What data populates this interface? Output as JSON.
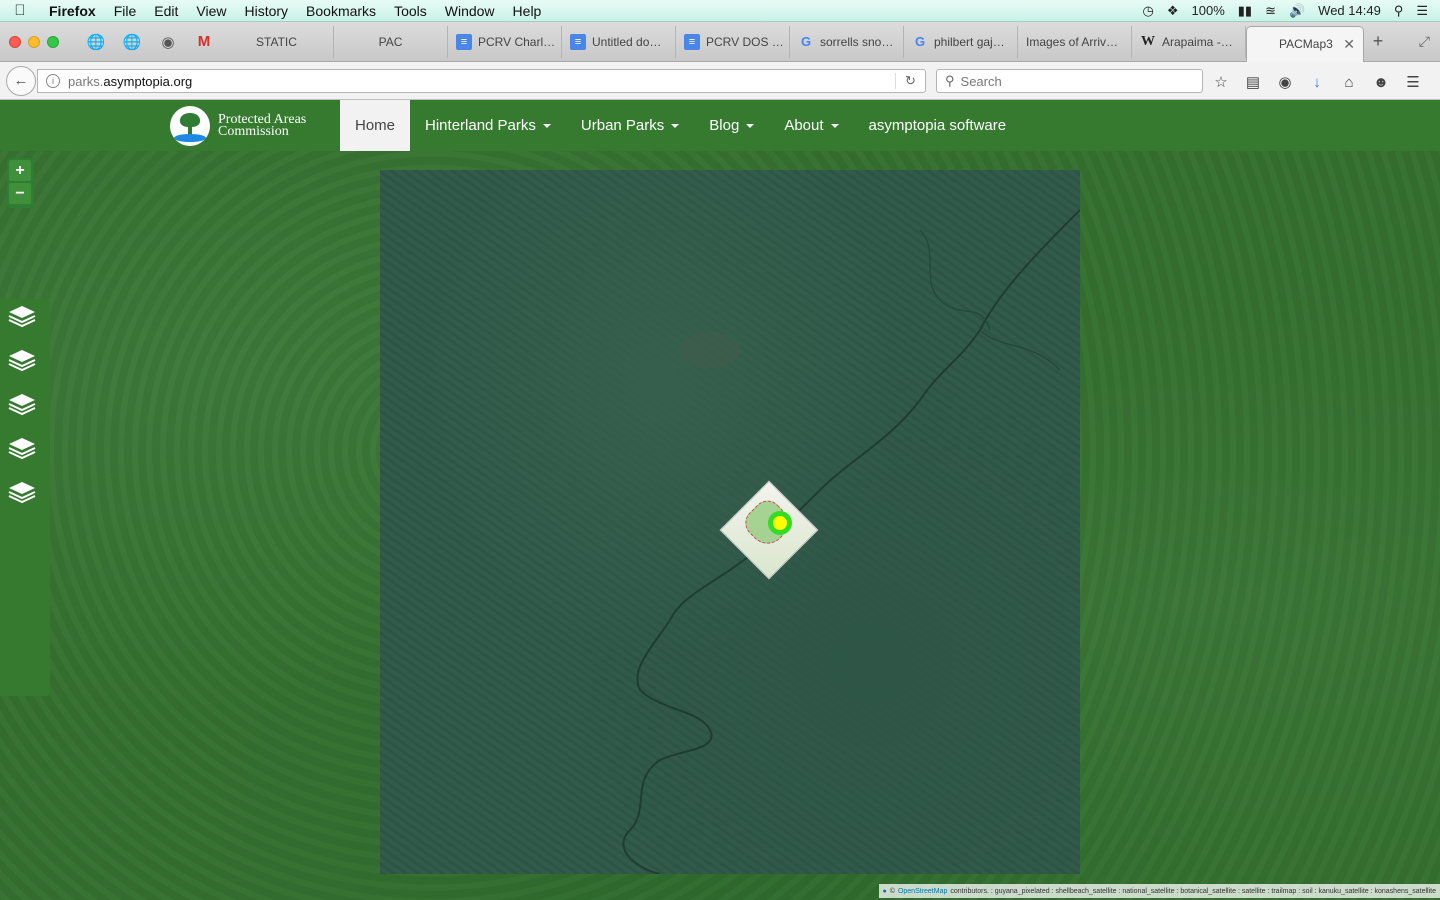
{
  "menubar": {
    "app": "Firefox",
    "items": [
      "File",
      "Edit",
      "View",
      "History",
      "Bookmarks",
      "Tools",
      "Window",
      "Help"
    ],
    "battery": "100%",
    "clock": "Wed 14:49"
  },
  "tabs": {
    "items": [
      {
        "label": "STATIC",
        "icon": "none"
      },
      {
        "label": "PAC",
        "icon": "none"
      },
      {
        "label": "PCRV Charl…",
        "icon": "docs-icon"
      },
      {
        "label": "Untitled do…",
        "icon": "docs-icon"
      },
      {
        "label": "PCRV DOS …",
        "icon": "docs-icon"
      },
      {
        "label": "sorrells sno…",
        "icon": "google-icon"
      },
      {
        "label": "philbert gaj…",
        "icon": "google-icon"
      },
      {
        "label": "Images of Arriv…",
        "icon": "none"
      },
      {
        "label": "Arapaima -…",
        "icon": "wikipedia-icon"
      }
    ],
    "active": "PACMap3"
  },
  "navbar": {
    "url_host": "parks.",
    "url_domain": "asymptopia.org",
    "search_placeholder": "Search"
  },
  "site": {
    "brand_line1": "Protected Areas",
    "brand_line2": "Commission",
    "nav": [
      {
        "label": "Home",
        "active": true,
        "dropdown": false
      },
      {
        "label": "Hinterland Parks",
        "active": false,
        "dropdown": true
      },
      {
        "label": "Urban Parks",
        "active": false,
        "dropdown": true
      },
      {
        "label": "Blog",
        "active": false,
        "dropdown": true
      },
      {
        "label": "About",
        "active": false,
        "dropdown": true
      },
      {
        "label": "asymptopia software",
        "active": false,
        "dropdown": false
      }
    ]
  },
  "map": {
    "zoom_in": "+",
    "zoom_out": "−",
    "layer_buttons": 5,
    "attribution_link": "OpenStreetMap",
    "attribution_text": "contributors. : guyana_pixelated : shellbeach_satellite : national_satellite : botanical_satellite : satellite : trailmap : soil : kanuku_satellite : konashens_satellite"
  },
  "colors": {
    "header_green": "#357a2f",
    "marker_fill": "#ffff00",
    "marker_ring": "#33dd22"
  }
}
